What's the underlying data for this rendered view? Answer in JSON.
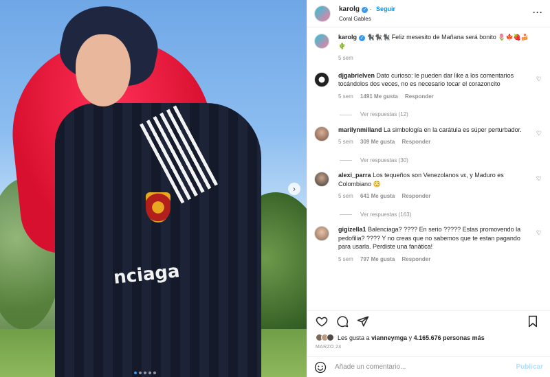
{
  "post": {
    "photo_logo_text": "nciaga",
    "carousel_dots": 5,
    "active_dot": 0
  },
  "header": {
    "username": "karolg",
    "follow_label": "Seguir",
    "location": "Coral Gables",
    "more_label": "···"
  },
  "caption": {
    "username": "karolg",
    "text": "🐈‍⬛🐈‍⬛🐈‍⬛ Feliz mesesito de Mañana será bonito 🌷🍁🍓🍰🌵",
    "time": "5 sem"
  },
  "comments": [
    {
      "username": "djgabrielven",
      "text": "Dato curioso: le pueden dar like a los comentarios tocándolos dos veces, no es necesario tocar el corazoncito",
      "time": "5 sem",
      "likes": "1491 Me gusta",
      "reply": "Responder",
      "replies": "Ver respuestas (12)"
    },
    {
      "username": "marilynmilland",
      "text": "La simbología en la carátula es súper perturbador.",
      "time": "5 sem",
      "likes": "309 Me gusta",
      "reply": "Responder",
      "replies": "Ver respuestas (30)"
    },
    {
      "username": "alexi_parra",
      "text": "Los tequeños son Venezolanos vɛ, y Maduro es Colombiano 😳",
      "time": "5 sem",
      "likes": "641 Me gusta",
      "reply": "Responder",
      "replies": "Ver respuestas (163)"
    },
    {
      "username": "gigizella1",
      "text": "Balenciaga? ???? En serio ????? Estas promovendo la pedofilia? ???? Y no creas que no sabemos que te estan pagando para usarla. Perdiste una fanática!",
      "time": "5 sem",
      "likes": "797 Me gusta",
      "reply": "Responder"
    }
  ],
  "likes": {
    "prefix": "Les gusta a",
    "user": "vianneymga",
    "joiner": "y",
    "count": "4.165.676 personas más"
  },
  "date": "MARZO 24",
  "composer": {
    "placeholder": "Añade un comentario...",
    "publish_label": "Publicar"
  },
  "icons": [
    "like-icon",
    "comment-icon",
    "share-icon",
    "save-icon",
    "emoji-icon",
    "verified-icon",
    "next-arrow-icon",
    "more-icon"
  ]
}
